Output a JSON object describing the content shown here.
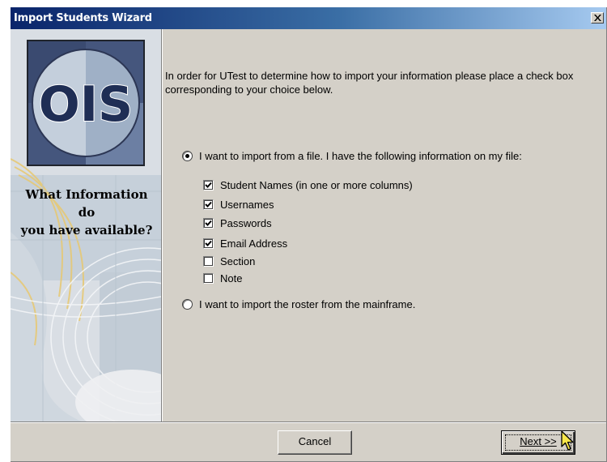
{
  "window": {
    "title": "Import Students Wizard",
    "close_icon": "close-x-icon"
  },
  "side_panel": {
    "logo_text": "OIS",
    "heading_line1": "What Information do",
    "heading_line2": "you have available?"
  },
  "main": {
    "instructions": "In order for UTest to determine how to import your information please place a check box corresponding to your choice below.",
    "option_file": {
      "label": "I want to import from a file.  I have the following information on my file:",
      "selected": true
    },
    "fields": [
      {
        "label": "Student Names (in one or more columns)",
        "checked": true
      },
      {
        "label": "Usernames",
        "checked": true
      },
      {
        "label": "Passwords",
        "checked": true
      },
      {
        "label": "Email Address",
        "checked": true
      },
      {
        "label": "Section",
        "checked": false
      },
      {
        "label": "Note",
        "checked": false
      }
    ],
    "option_mainframe": {
      "label": "I want to import the roster from the mainframe.",
      "selected": false
    }
  },
  "footer": {
    "cancel_label": "Cancel",
    "next_label": "Next >>"
  },
  "colors": {
    "title_bar": "#0a246a",
    "dialog_face": "#d4d0c8"
  }
}
